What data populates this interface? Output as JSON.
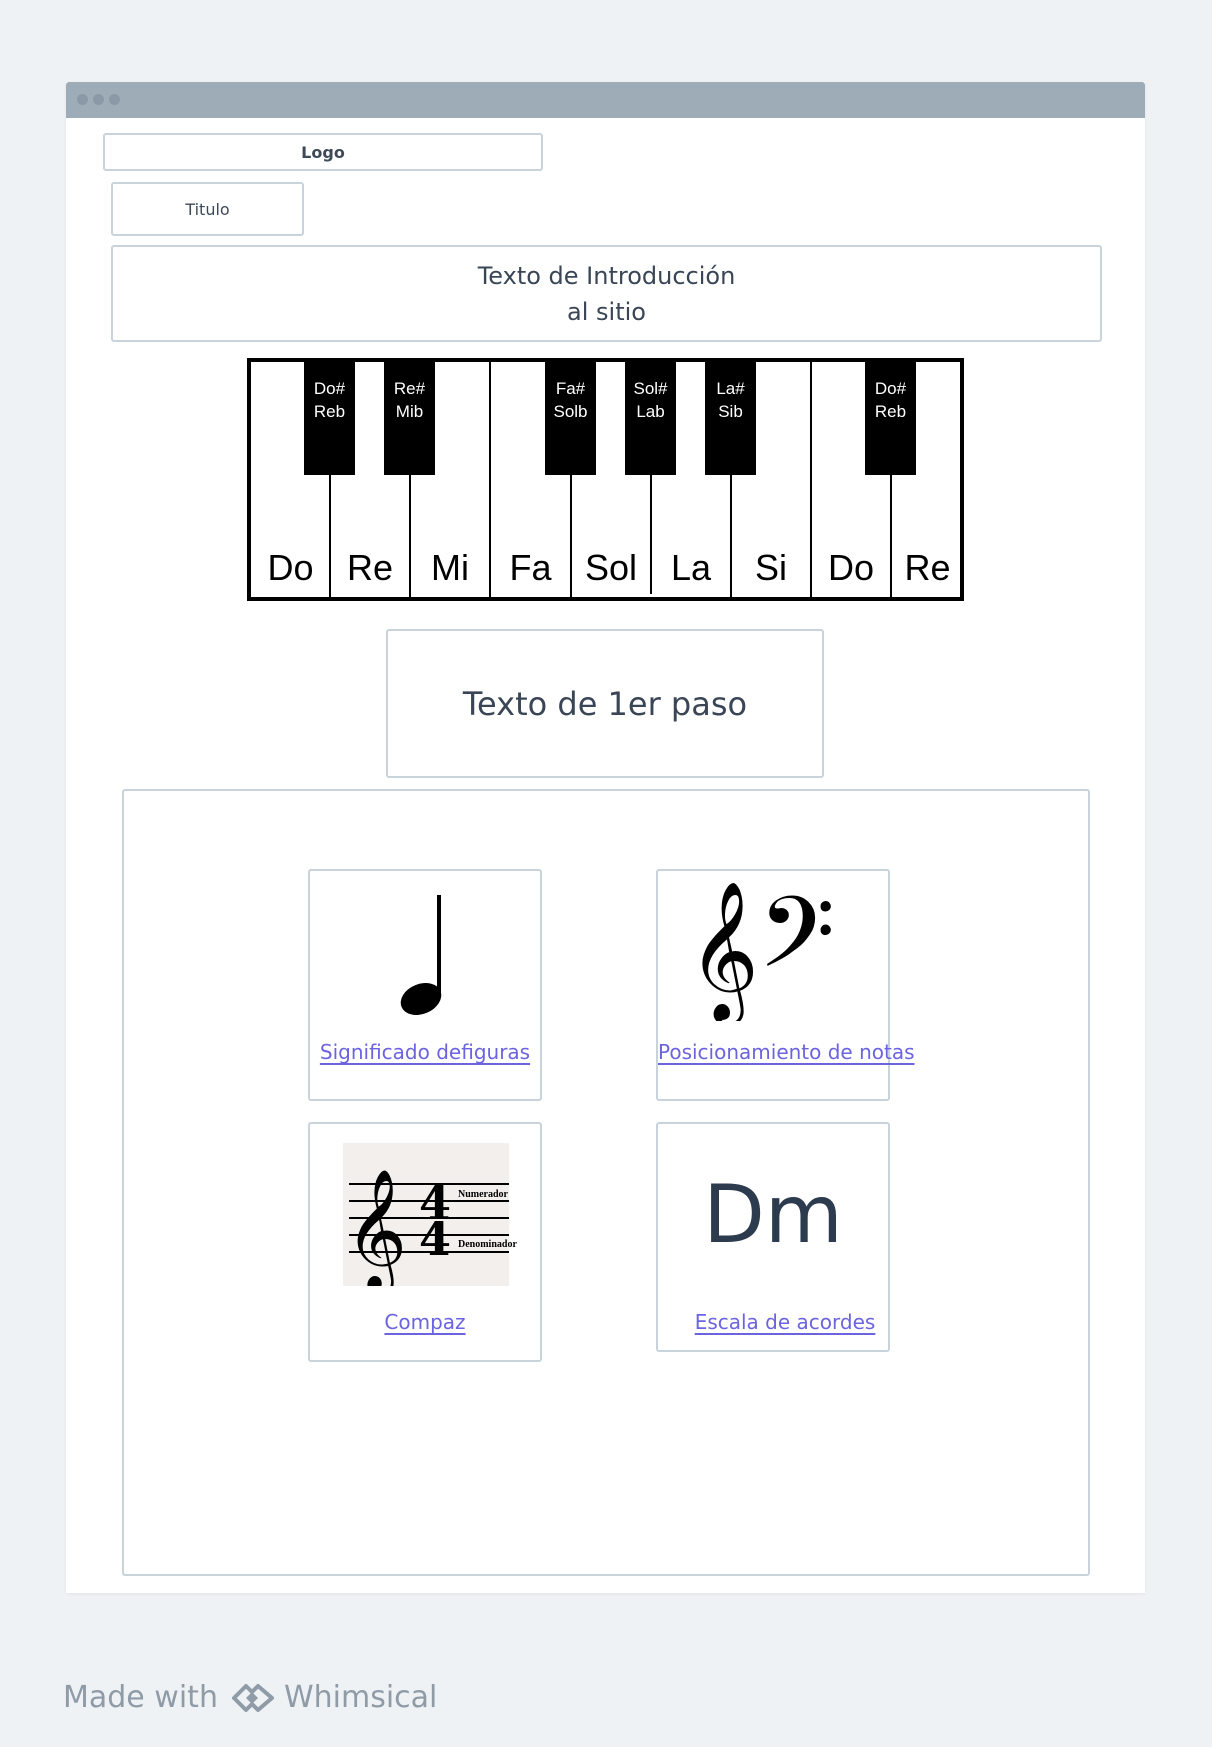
{
  "header": {
    "logo_label": "Logo",
    "title_label": "Titulo"
  },
  "intro": {
    "line1": "Texto de Introducción",
    "line2": "al sitio"
  },
  "piano": {
    "white_keys": [
      "Do",
      "Re",
      "Mi",
      "Fa",
      "Sol",
      "La",
      "Si",
      "Do",
      "Re"
    ],
    "black_keys": [
      {
        "sharp": "Do#",
        "flat": "Reb"
      },
      {
        "sharp": "Re#",
        "flat": "Mib"
      },
      {
        "sharp": "Fa#",
        "flat": "Solb"
      },
      {
        "sharp": "Sol#",
        "flat": "Lab"
      },
      {
        "sharp": "La#",
        "flat": "Sib"
      },
      {
        "sharp": "Do#",
        "flat": "Reb"
      }
    ]
  },
  "step": {
    "text": "Texto de 1er paso"
  },
  "cards": {
    "figuras": {
      "link": "Significado defiguras",
      "icon": "quarter-note-icon"
    },
    "notas": {
      "link": "Posicionamiento de notas",
      "icon": "clefs-icon"
    },
    "compaz": {
      "link": "Compaz",
      "img_top": "Numerador",
      "img_bottom": "Denominador",
      "icon": "time-signature-image"
    },
    "acordes": {
      "link": "Escala de acordes",
      "symbol": "Dm"
    }
  },
  "footer": {
    "made_with": "Made with",
    "brand": "Whimsical"
  },
  "colors": {
    "link": "#6c63e0",
    "border": "#c9d3dc",
    "titlebar": "#9eacb8"
  }
}
